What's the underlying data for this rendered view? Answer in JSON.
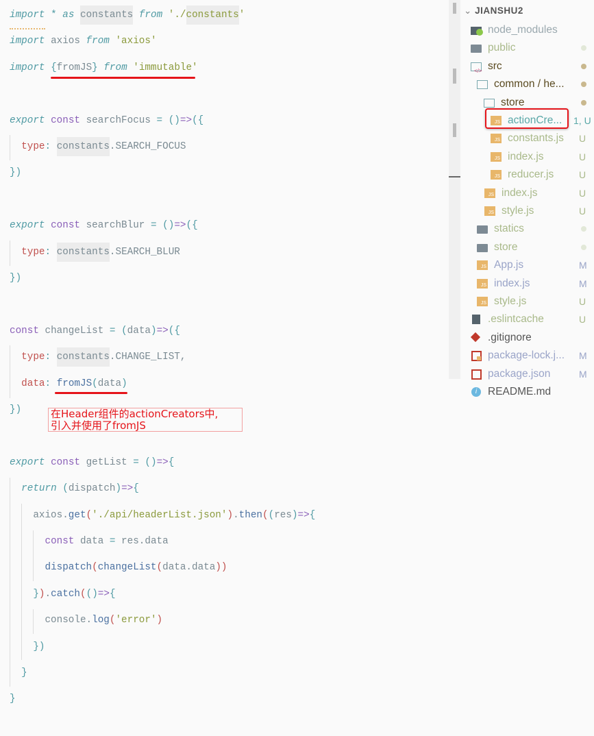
{
  "editor": {
    "lines": [
      [
        [
          "kw",
          "import"
        ],
        [
          "id",
          " "
        ],
        [
          "pu",
          "*"
        ],
        [
          "id",
          " "
        ],
        [
          "kw",
          "as"
        ],
        [
          "id",
          " "
        ],
        [
          "id hl",
          "constants"
        ],
        [
          "id",
          " "
        ],
        [
          "kw",
          "from"
        ],
        [
          "id",
          " "
        ],
        [
          "str",
          "'./"
        ],
        [
          "str hl",
          "constants"
        ],
        [
          "str",
          "'"
        ]
      ],
      [
        [
          "kw",
          "import"
        ],
        [
          "id",
          " axios "
        ],
        [
          "kw",
          "from"
        ],
        [
          "id",
          " "
        ],
        [
          "str",
          "'axios'"
        ]
      ],
      [
        [
          "kw",
          "import"
        ],
        [
          "id",
          " "
        ],
        [
          "pu",
          "{"
        ],
        [
          "id",
          "fromJS"
        ],
        [
          "pu",
          "}"
        ],
        [
          "id",
          " "
        ],
        [
          "kw",
          "from"
        ],
        [
          "id",
          " "
        ],
        [
          "str",
          "'immutable'"
        ]
      ],
      [],
      [
        [
          "kw",
          "export"
        ],
        [
          "id",
          " "
        ],
        [
          "st",
          "const"
        ],
        [
          "id",
          " searchFocus "
        ],
        [
          "pu",
          "="
        ],
        [
          "id",
          " "
        ],
        [
          "pu",
          "()"
        ],
        [
          "st",
          "=>"
        ],
        [
          "pu",
          "({"
        ]
      ],
      [
        [
          "id",
          "  "
        ],
        [
          "pr",
          "type"
        ],
        [
          "pu",
          ":"
        ],
        [
          "id",
          " "
        ],
        [
          "id hl",
          "constants"
        ],
        [
          "id",
          ".SEARCH_FOCUS"
        ]
      ],
      [
        [
          "pu",
          "})"
        ]
      ],
      [],
      [
        [
          "kw",
          "export"
        ],
        [
          "id",
          " "
        ],
        [
          "st",
          "const"
        ],
        [
          "id",
          " searchBlur "
        ],
        [
          "pu",
          "="
        ],
        [
          "id",
          " "
        ],
        [
          "pu",
          "()"
        ],
        [
          "st",
          "=>"
        ],
        [
          "pu",
          "({"
        ]
      ],
      [
        [
          "id",
          "  "
        ],
        [
          "pr",
          "type"
        ],
        [
          "pu",
          ":"
        ],
        [
          "id",
          " "
        ],
        [
          "id hl",
          "constants"
        ],
        [
          "id",
          ".SEARCH_BLUR"
        ]
      ],
      [
        [
          "pu",
          "})"
        ]
      ],
      [],
      [
        [
          "st",
          "const"
        ],
        [
          "id",
          " changeList "
        ],
        [
          "pu",
          "="
        ],
        [
          "id",
          " "
        ],
        [
          "pu",
          "("
        ],
        [
          "id",
          "data"
        ],
        [
          "pu",
          ")"
        ],
        [
          "st",
          "=>"
        ],
        [
          "pu",
          "({"
        ]
      ],
      [
        [
          "id",
          "  "
        ],
        [
          "pr",
          "type"
        ],
        [
          "pu",
          ":"
        ],
        [
          "id",
          " "
        ],
        [
          "id hl",
          "constants"
        ],
        [
          "id",
          ".CHANGE_LIST,"
        ]
      ],
      [
        [
          "id",
          "  "
        ],
        [
          "pr",
          "data"
        ],
        [
          "pu",
          ":"
        ],
        [
          "id",
          " "
        ],
        [
          "fn",
          "fromJS"
        ],
        [
          "pu",
          "("
        ],
        [
          "id",
          "data"
        ],
        [
          "pu",
          ")"
        ]
      ],
      [
        [
          "pu",
          "})"
        ]
      ],
      [],
      [
        [
          "kw",
          "export"
        ],
        [
          "id",
          " "
        ],
        [
          "st",
          "const"
        ],
        [
          "id",
          " getList "
        ],
        [
          "pu",
          "="
        ],
        [
          "id",
          " "
        ],
        [
          "pu",
          "()"
        ],
        [
          "st",
          "=>"
        ],
        [
          "pu",
          "{"
        ]
      ],
      [
        [
          "id",
          "  "
        ],
        [
          "kw",
          "return"
        ],
        [
          "id",
          " "
        ],
        [
          "pu",
          "("
        ],
        [
          "id",
          "dispatch"
        ],
        [
          "pu",
          ")"
        ],
        [
          "st",
          "=>"
        ],
        [
          "pu",
          "{"
        ]
      ],
      [
        [
          "id",
          "    axios."
        ],
        [
          "fn",
          "get"
        ],
        [
          "pn",
          "("
        ],
        [
          "str",
          "'./api/headerList.json'"
        ],
        [
          "pn",
          ")"
        ],
        [
          "id",
          "."
        ],
        [
          "fn",
          "then"
        ],
        [
          "pn",
          "("
        ],
        [
          "pu",
          "("
        ],
        [
          "id",
          "res"
        ],
        [
          "pu",
          ")"
        ],
        [
          "st",
          "=>"
        ],
        [
          "pu",
          "{"
        ]
      ],
      [
        [
          "id",
          "      "
        ],
        [
          "st",
          "const"
        ],
        [
          "id",
          " data "
        ],
        [
          "pu",
          "="
        ],
        [
          "id",
          " res.data"
        ]
      ],
      [
        [
          "id",
          "      "
        ],
        [
          "fn",
          "dispatch"
        ],
        [
          "pn",
          "("
        ],
        [
          "fn",
          "changeList"
        ],
        [
          "pn",
          "("
        ],
        [
          "id",
          "data.data"
        ],
        [
          "pn",
          "))"
        ]
      ],
      [
        [
          "id",
          "    "
        ],
        [
          "pu",
          "}"
        ],
        [
          "pn",
          ")"
        ],
        [
          "id",
          "."
        ],
        [
          "fn",
          "catch"
        ],
        [
          "pn",
          "("
        ],
        [
          "pu",
          "()"
        ],
        [
          "st",
          "=>"
        ],
        [
          "pu",
          "{"
        ]
      ],
      [
        [
          "id",
          "      console."
        ],
        [
          "fn",
          "log"
        ],
        [
          "pn",
          "("
        ],
        [
          "str",
          "'error'"
        ],
        [
          "pn",
          ")"
        ]
      ],
      [
        [
          "id",
          "    "
        ],
        [
          "pu",
          "})"
        ]
      ],
      [
        [
          "id",
          "  "
        ],
        [
          "pu",
          "}"
        ]
      ],
      [
        [
          "pu",
          "}"
        ]
      ]
    ],
    "annotation": [
      "在Header组件的actionCreators中,",
      "引入并使用了fromJS"
    ]
  },
  "explorer": {
    "root": "JIANSHU2",
    "items": [
      {
        "label": "node_modules",
        "indent": 0,
        "icon": "node-folder",
        "color": "#9aa8ae"
      },
      {
        "label": "public",
        "indent": 0,
        "icon": "folder-filled",
        "color": "#a9b98a",
        "dot": "#e2e8d8"
      },
      {
        "label": "src",
        "indent": 0,
        "icon": "src-folder",
        "color": "#5a4a20",
        "dot": "#c9b88e"
      },
      {
        "label": "common / he...",
        "indent": 1,
        "icon": "folder-open",
        "color": "#5a4a20",
        "dot": "#c9b88e"
      },
      {
        "label": "store",
        "indent": 2,
        "icon": "folder-open",
        "color": "#5a4a20",
        "dot": "#c9b88e"
      },
      {
        "label": "actionCre...",
        "indent": 3,
        "icon": "js-file",
        "color": "#5aa8a8",
        "status": "1, U"
      },
      {
        "label": "constants.js",
        "indent": 3,
        "icon": "js-file",
        "color": "#a9b98a",
        "status": "U"
      },
      {
        "label": "index.js",
        "indent": 3,
        "icon": "js-file",
        "color": "#a9b98a",
        "status": "U"
      },
      {
        "label": "reducer.js",
        "indent": 3,
        "icon": "js-file",
        "color": "#a9b98a",
        "status": "U"
      },
      {
        "label": "index.js",
        "indent": 2,
        "icon": "js-file",
        "color": "#a9b98a",
        "status": "U"
      },
      {
        "label": "style.js",
        "indent": 2,
        "icon": "js-file",
        "color": "#a9b98a",
        "status": "U"
      },
      {
        "label": "statics",
        "indent": 1,
        "icon": "folder-filled",
        "color": "#a9b98a",
        "dot": "#e2e8d8"
      },
      {
        "label": "store",
        "indent": 1,
        "icon": "folder-filled",
        "color": "#a9b98a",
        "dot": "#e2e8d8"
      },
      {
        "label": "App.js",
        "indent": 1,
        "icon": "js-file",
        "color": "#9aa4c8",
        "status": "M"
      },
      {
        "label": "index.js",
        "indent": 1,
        "icon": "js-file",
        "color": "#9aa4c8",
        "status": "M"
      },
      {
        "label": "style.js",
        "indent": 1,
        "icon": "js-file",
        "color": "#a9b98a",
        "status": "U"
      },
      {
        "label": ".eslintcache",
        "indent": 0,
        "icon": "file",
        "color": "#a9b98a",
        "status": "U"
      },
      {
        "label": ".gitignore",
        "indent": 0,
        "icon": "git-icon",
        "color": "#555"
      },
      {
        "label": "package-lock.j...",
        "indent": 0,
        "icon": "npm-lock",
        "color": "#9aa4c8",
        "status": "M"
      },
      {
        "label": "package.json",
        "indent": 0,
        "icon": "npm",
        "color": "#9aa4c8",
        "status": "M"
      },
      {
        "label": "README.md",
        "indent": 0,
        "icon": "info",
        "color": "#555"
      }
    ]
  }
}
